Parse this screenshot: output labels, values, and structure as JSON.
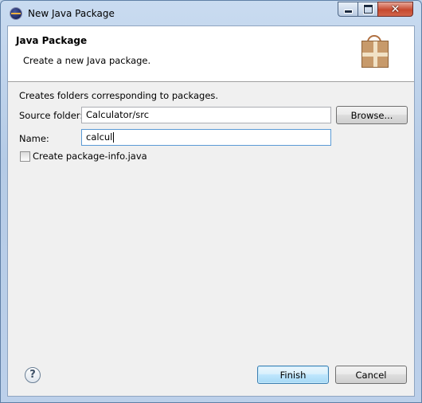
{
  "window": {
    "title": "New Java Package",
    "controls": {
      "close_glyph": "✕"
    }
  },
  "banner": {
    "title": "Java Package",
    "message": "Create a new Java package.",
    "icon": "package-gift-icon"
  },
  "form": {
    "description": "Creates folders corresponding to packages.",
    "source_folder": {
      "label": "Source folder:",
      "value": "Calculator/src",
      "browse_label": "Browse..."
    },
    "name": {
      "label": "Name:",
      "value": "calcul"
    },
    "create_package_info": {
      "label": "Create package-info.java",
      "checked": false
    }
  },
  "footer": {
    "help_glyph": "?",
    "finish_label": "Finish",
    "cancel_label": "Cancel"
  },
  "colors": {
    "title_bar": "#bcd0ea",
    "dialog_bg": "#f0f0f0",
    "default_button_border": "#3c7fb1"
  }
}
